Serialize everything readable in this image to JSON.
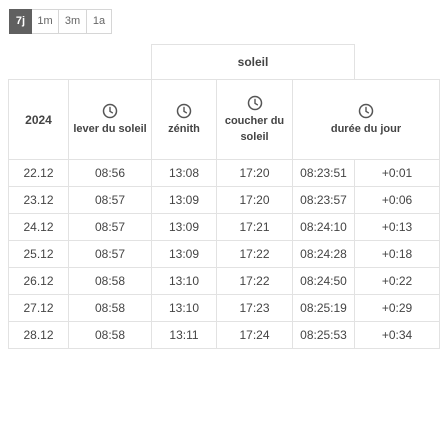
{
  "range_tabs": [
    {
      "label": "7j",
      "selected": true
    },
    {
      "label": "1m",
      "selected": false
    },
    {
      "label": "3m",
      "selected": false
    },
    {
      "label": "1a",
      "selected": false
    }
  ],
  "table": {
    "group_header": "soleil",
    "year": "2024",
    "columns": {
      "sunrise": {
        "label": "lever du soleil",
        "icon": "clock-icon"
      },
      "zenith": {
        "label": "zénith",
        "icon": "clock-icon"
      },
      "sunset": {
        "label": "coucher du soleil",
        "icon": "clock-icon"
      },
      "daylength": {
        "label": "durée du jour",
        "icon": "clock-icon"
      }
    },
    "rows": [
      {
        "date": "22.12",
        "sunrise": "08:56",
        "zenith": "13:08",
        "sunset": "17:20",
        "daylength": "08:23:51",
        "delta": "+0:01"
      },
      {
        "date": "23.12",
        "sunrise": "08:57",
        "zenith": "13:09",
        "sunset": "17:20",
        "daylength": "08:23:57",
        "delta": "+0:06"
      },
      {
        "date": "24.12",
        "sunrise": "08:57",
        "zenith": "13:09",
        "sunset": "17:21",
        "daylength": "08:24:10",
        "delta": "+0:13"
      },
      {
        "date": "25.12",
        "sunrise": "08:57",
        "zenith": "13:09",
        "sunset": "17:22",
        "daylength": "08:24:28",
        "delta": "+0:18"
      },
      {
        "date": "26.12",
        "sunrise": "08:58",
        "zenith": "13:10",
        "sunset": "17:22",
        "daylength": "08:24:50",
        "delta": "+0:22"
      },
      {
        "date": "27.12",
        "sunrise": "08:58",
        "zenith": "13:10",
        "sunset": "17:23",
        "daylength": "08:25:19",
        "delta": "+0:29"
      },
      {
        "date": "28.12",
        "sunrise": "08:58",
        "zenith": "13:11",
        "sunset": "17:24",
        "daylength": "08:25:53",
        "delta": "+0:34"
      }
    ]
  }
}
